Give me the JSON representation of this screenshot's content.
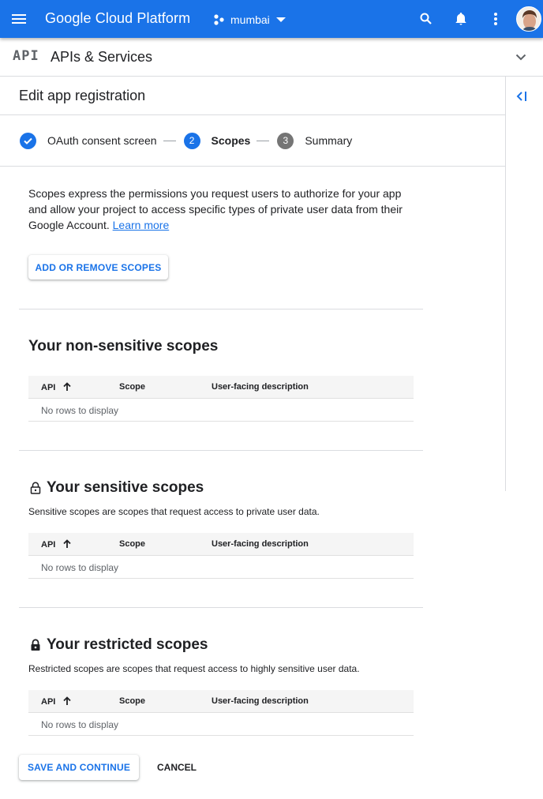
{
  "topbar": {
    "brand": "Google Cloud Platform",
    "project": "mumbai",
    "icons": [
      "menu-icon",
      "search-icon",
      "notifications-icon",
      "more-vert-icon",
      "avatar"
    ],
    "color": "#1a73e8"
  },
  "subbar": {
    "logo": "API",
    "title": "APIs & Services"
  },
  "page": {
    "title": "Edit app registration"
  },
  "stepper": {
    "steps": [
      {
        "number": "✓",
        "label": "OAuth consent screen",
        "state": "done"
      },
      {
        "number": "2",
        "label": "Scopes",
        "state": "active"
      },
      {
        "number": "3",
        "label": "Summary",
        "state": "todo"
      }
    ]
  },
  "intro": {
    "text": "Scopes express the permissions you request users to authorize for your app and allow your project to access specific types of private user data from their Google Account. ",
    "link": "Learn more"
  },
  "buttons": {
    "add_remove": "ADD OR REMOVE SCOPES",
    "save": "SAVE AND CONTINUE",
    "cancel": "CANCEL"
  },
  "table_columns": [
    "API",
    "Scope",
    "User-facing description"
  ],
  "sections": [
    {
      "title": "Your non-sensitive scopes",
      "description": "",
      "empty": "No rows to display"
    },
    {
      "title": "Your sensitive scopes",
      "description": "Sensitive scopes are scopes that request access to private user data.",
      "empty": "No rows to display"
    },
    {
      "title": "Your restricted scopes",
      "description": "Restricted scopes are scopes that request access to highly sensitive user data.",
      "empty": "No rows to display"
    }
  ]
}
